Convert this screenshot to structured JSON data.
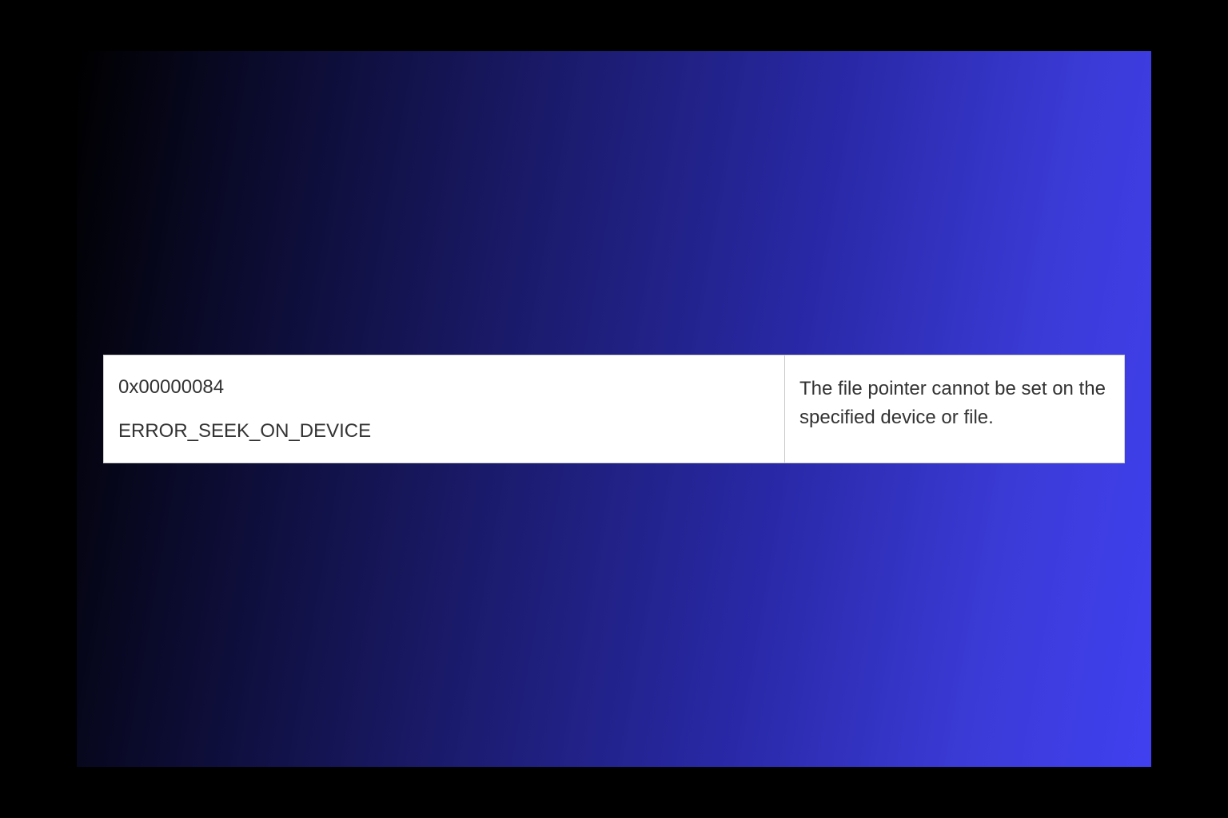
{
  "error": {
    "code": "0x00000084",
    "name": "ERROR_SEEK_ON_DEVICE",
    "description": "The file pointer cannot be set on the specified device or file."
  }
}
